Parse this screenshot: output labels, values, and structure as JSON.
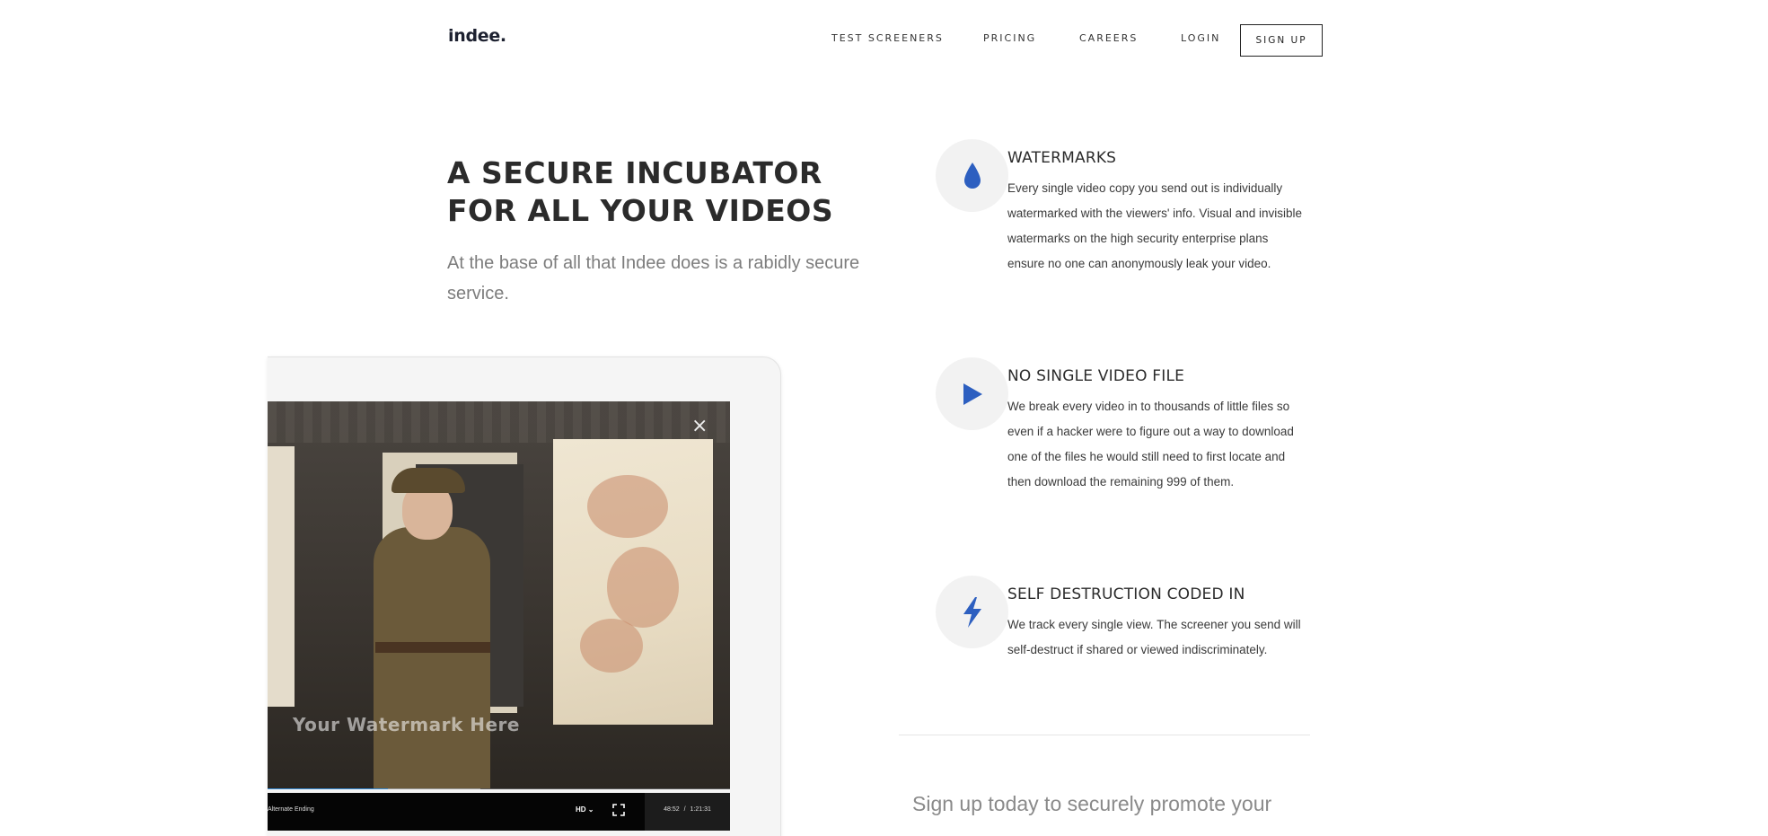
{
  "header": {
    "logo": "indee.",
    "nav": [
      "TEST SCREENERS",
      "PRICING",
      "CAREERS",
      "LOGIN"
    ],
    "signup_label": "SIGN UP"
  },
  "hero": {
    "title_line1": "A SECURE INCUBATOR",
    "title_line2": "FOR ALL YOUR VIDEOS",
    "subtitle": "At the base of all that Indee does is a rabidly secure service."
  },
  "video_player": {
    "watermark": "Your Watermark Here",
    "title": "Alternate Ending",
    "quality": "HD",
    "current_time": "48:52",
    "separator": "/",
    "duration": "1:21:31",
    "progress_fraction": 0.26,
    "buffered_fraction": 0.46,
    "accent_color": "#3a8fd8"
  },
  "features": [
    {
      "icon": "droplet-icon",
      "title": "WATERMARKS",
      "body": "Every single video copy you send out is individually watermarked with the viewers' info. Visual and invisible watermarks on the high security enterprise plans ensure no one can anonymously leak your video."
    },
    {
      "icon": "play-icon",
      "title": "NO SINGLE VIDEO FILE",
      "body": "We break every video in to thousands of little files so even if a hacker were to figure out a way to download one of the files he would still need to first locate and then download the remaining 999 of them."
    },
    {
      "icon": "lightning-icon",
      "title": "SELF DESTRUCTION CODED IN",
      "body": "We track every single view. The screener you send will self-destruct if shared or viewed indiscriminately."
    }
  ],
  "cta": {
    "text": "Sign up today to securely promote your"
  },
  "colors": {
    "icon_blue": "#2d5fc0",
    "icon_circle": "#f2f2f2"
  }
}
